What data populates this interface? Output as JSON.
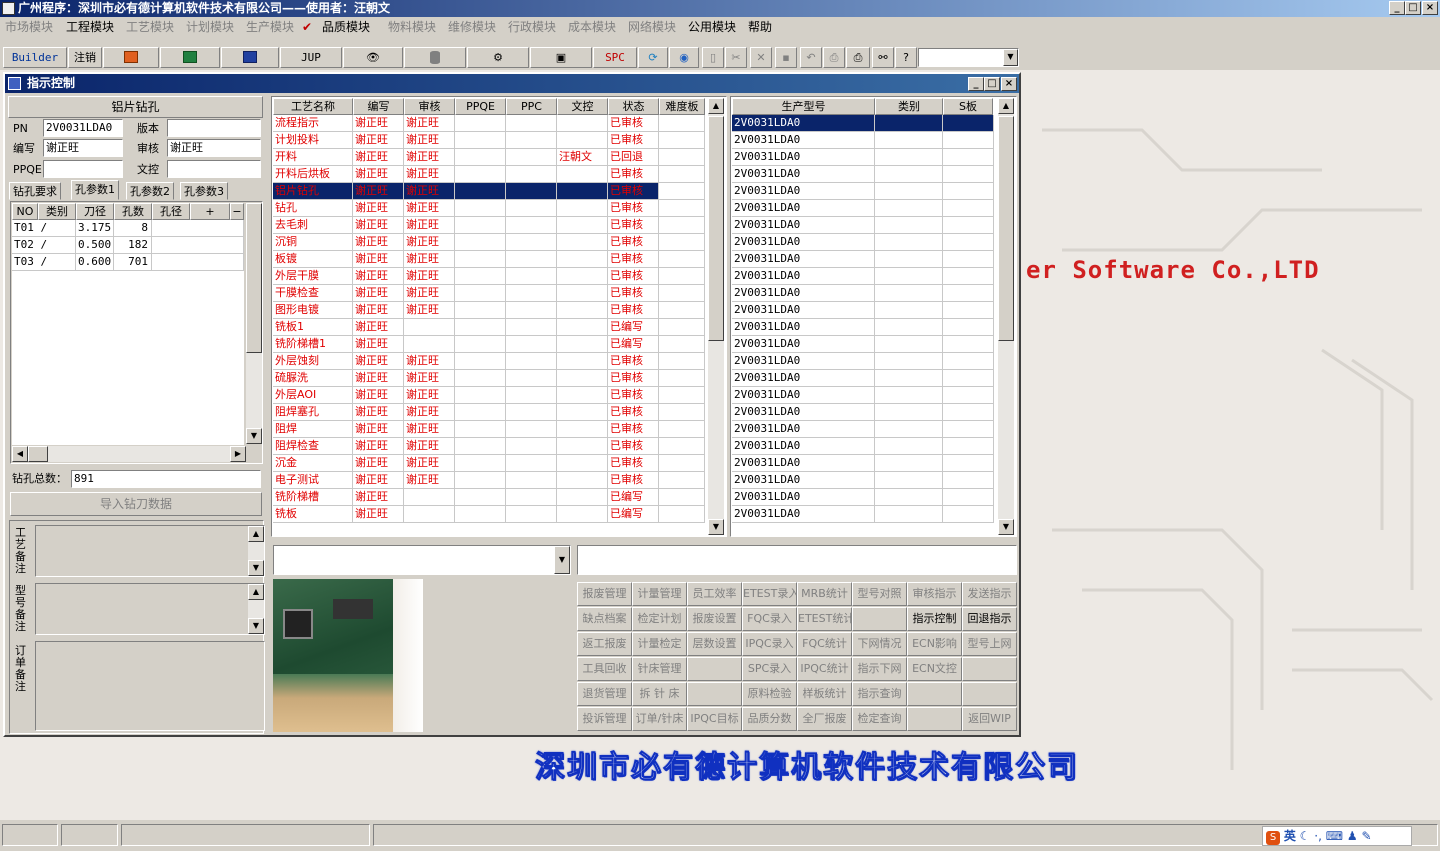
{
  "app": {
    "title": "广州程序：深圳市必有德计算机软件技术有限公司——使用者：汪朝文"
  },
  "menu": {
    "items": [
      {
        "label": "市场模块",
        "enabled": false
      },
      {
        "label": "工程模块",
        "enabled": true
      },
      {
        "label": "工艺模块",
        "enabled": false
      },
      {
        "label": "计划模块",
        "enabled": false
      },
      {
        "label": "生产模块",
        "enabled": false
      },
      {
        "label": "品质模块",
        "enabled": true
      },
      {
        "label": "物料模块",
        "enabled": false
      },
      {
        "label": "维修模块",
        "enabled": false
      },
      {
        "label": "行政模块",
        "enabled": false
      },
      {
        "label": "成本模块",
        "enabled": false
      },
      {
        "label": "网络模块",
        "enabled": false
      },
      {
        "label": "公用模块",
        "enabled": true
      },
      {
        "label": "帮助",
        "enabled": true
      }
    ]
  },
  "toolbar": {
    "builder": "Builder",
    "logout": "注销",
    "jup": "JUP",
    "spc": "SPC"
  },
  "window": {
    "title": "指示控制"
  },
  "left": {
    "section_title": "铝片钻孔",
    "pn_label": "PN",
    "pn_value": "2V0031LDA0",
    "version_label": "版本",
    "version_value": "",
    "author_label": "编写",
    "author_value": "谢正旺",
    "reviewer_label": "审核",
    "reviewer_value": "谢正旺",
    "ppqe_label": "PPQE",
    "ppqe_value": "",
    "proof_label": "文控",
    "proof_value": "",
    "tabs": [
      "钻孔要求",
      "孔参数1",
      "孔参数2",
      "孔参数3"
    ],
    "tool_headers": [
      "NO",
      "类别",
      "刀径",
      "孔数",
      "孔径",
      "+",
      "−"
    ],
    "tools": [
      {
        "no": "T01 /",
        "dia": "3.175",
        "count": "8"
      },
      {
        "no": "T02 /",
        "dia": "0.500",
        "count": "182"
      },
      {
        "no": "T03 /",
        "dia": "0.600",
        "count": "701"
      }
    ],
    "total_label": "钻孔总数：",
    "total_value": "891",
    "import_button": "导入钻刀数据",
    "note1": "工艺备注",
    "note2": "型号备注",
    "note3": "订单备注"
  },
  "process_grid": {
    "headers": [
      "工艺名称",
      "编写",
      "审核",
      "PPQE",
      "PPC",
      "文控",
      "状态",
      "难度板"
    ],
    "rows": [
      {
        "name": "流程指示",
        "author": "谢正旺",
        "reviewer": "谢正旺",
        "proof": "",
        "status": "已审核"
      },
      {
        "name": "计划投料",
        "author": "谢正旺",
        "reviewer": "谢正旺",
        "proof": "",
        "status": "已审核"
      },
      {
        "name": "开料",
        "author": "谢正旺",
        "reviewer": "谢正旺",
        "proof": "汪朝文",
        "status": "已回退"
      },
      {
        "name": "开料后烘板",
        "author": "谢正旺",
        "reviewer": "谢正旺",
        "proof": "",
        "status": "已审核"
      },
      {
        "name": "铝片钻孔",
        "author": "谢正旺",
        "reviewer": "谢正旺",
        "proof": "",
        "status": "已审核"
      },
      {
        "name": "钻孔",
        "author": "谢正旺",
        "reviewer": "谢正旺",
        "proof": "",
        "status": "已审核"
      },
      {
        "name": "去毛刺",
        "author": "谢正旺",
        "reviewer": "谢正旺",
        "proof": "",
        "status": "已审核"
      },
      {
        "name": "沉铜",
        "author": "谢正旺",
        "reviewer": "谢正旺",
        "proof": "",
        "status": "已审核"
      },
      {
        "name": "板镀",
        "author": "谢正旺",
        "reviewer": "谢正旺",
        "proof": "",
        "status": "已审核"
      },
      {
        "name": "外层干膜",
        "author": "谢正旺",
        "reviewer": "谢正旺",
        "proof": "",
        "status": "已审核"
      },
      {
        "name": "干膜检查",
        "author": "谢正旺",
        "reviewer": "谢正旺",
        "proof": "",
        "status": "已审核"
      },
      {
        "name": "图形电镀",
        "author": "谢正旺",
        "reviewer": "谢正旺",
        "proof": "",
        "status": "已审核"
      },
      {
        "name": "铣板1",
        "author": "谢正旺",
        "reviewer": "",
        "proof": "",
        "status": "已编写"
      },
      {
        "name": "铣阶梯槽1",
        "author": "谢正旺",
        "reviewer": "",
        "proof": "",
        "status": "已编写"
      },
      {
        "name": "外层蚀刻",
        "author": "谢正旺",
        "reviewer": "谢正旺",
        "proof": "",
        "status": "已审核"
      },
      {
        "name": "硫脲洗",
        "author": "谢正旺",
        "reviewer": "谢正旺",
        "proof": "",
        "status": "已审核"
      },
      {
        "name": "外层AOI",
        "author": "谢正旺",
        "reviewer": "谢正旺",
        "proof": "",
        "status": "已审核"
      },
      {
        "name": "阻焊塞孔",
        "author": "谢正旺",
        "reviewer": "谢正旺",
        "proof": "",
        "status": "已审核"
      },
      {
        "name": "阻焊",
        "author": "谢正旺",
        "reviewer": "谢正旺",
        "proof": "",
        "status": "已审核"
      },
      {
        "name": "阻焊检查",
        "author": "谢正旺",
        "reviewer": "谢正旺",
        "proof": "",
        "status": "已审核"
      },
      {
        "name": "沉金",
        "author": "谢正旺",
        "reviewer": "谢正旺",
        "proof": "",
        "status": "已审核"
      },
      {
        "name": "电子测试",
        "author": "谢正旺",
        "reviewer": "谢正旺",
        "proof": "",
        "status": "已审核"
      },
      {
        "name": "铣阶梯槽",
        "author": "谢正旺",
        "reviewer": "",
        "proof": "",
        "status": "已编写"
      },
      {
        "name": "铣板",
        "author": "谢正旺",
        "reviewer": "",
        "proof": "",
        "status": "已编写"
      }
    ],
    "selected_index": 4
  },
  "model_grid": {
    "headers": [
      "生产型号",
      "类别",
      "S板"
    ],
    "rows": [
      "2V0031LDA0",
      "2V0031LDA0",
      "2V0031LDA0",
      "2V0031LDA0",
      "2V0031LDA0",
      "2V0031LDA0",
      "2V0031LDA0",
      "2V0031LDA0",
      "2V0031LDA0",
      "2V0031LDA0",
      "2V0031LDA0",
      "2V0031LDA0",
      "2V0031LDA0",
      "2V0031LDA0",
      "2V0031LDA0",
      "2V0031LDA0",
      "2V0031LDA0",
      "2V0031LDA0",
      "2V0031LDA0",
      "2V0031LDA0",
      "2V0031LDA0",
      "2V0031LDA0",
      "2V0031LDA0",
      "2V0031LDA0"
    ],
    "selected_index": 0
  },
  "buttons": [
    [
      {
        "label": "报废管理",
        "enabled": false
      },
      {
        "label": "计量管理",
        "enabled": false
      },
      {
        "label": "员工效率",
        "enabled": false
      },
      {
        "label": "ETEST录入",
        "enabled": false
      },
      {
        "label": "MRB统计",
        "enabled": false
      },
      {
        "label": "型号对照",
        "enabled": false
      },
      {
        "label": "审核指示",
        "enabled": false
      },
      {
        "label": "发送指示",
        "enabled": false
      }
    ],
    [
      {
        "label": "缺点档案",
        "enabled": false
      },
      {
        "label": "检定计划",
        "enabled": false
      },
      {
        "label": "报废设置",
        "enabled": false
      },
      {
        "label": "FQC录入",
        "enabled": false
      },
      {
        "label": "ETEST统计",
        "enabled": false
      },
      {
        "label": "",
        "enabled": false
      },
      {
        "label": "指示控制",
        "enabled": true
      },
      {
        "label": "回退指示",
        "enabled": true
      }
    ],
    [
      {
        "label": "返工报废",
        "enabled": false
      },
      {
        "label": "计量检定",
        "enabled": false
      },
      {
        "label": "层数设置",
        "enabled": false
      },
      {
        "label": "IPQC录入",
        "enabled": false
      },
      {
        "label": "FQC统计",
        "enabled": false
      },
      {
        "label": "下网情况",
        "enabled": false
      },
      {
        "label": "ECN影响",
        "enabled": false
      },
      {
        "label": "型号上网",
        "enabled": false
      }
    ],
    [
      {
        "label": "工具回收",
        "enabled": false
      },
      {
        "label": "针床管理",
        "enabled": false
      },
      {
        "label": "",
        "enabled": false
      },
      {
        "label": "SPC录入",
        "enabled": false
      },
      {
        "label": "IPQC统计",
        "enabled": false
      },
      {
        "label": "指示下网",
        "enabled": false
      },
      {
        "label": "ECN文控",
        "enabled": false
      },
      {
        "label": "",
        "enabled": false
      }
    ],
    [
      {
        "label": "退货管理",
        "enabled": false
      },
      {
        "label": "拆 针 床",
        "enabled": false
      },
      {
        "label": "",
        "enabled": false
      },
      {
        "label": "原料检验",
        "enabled": false
      },
      {
        "label": "样板统计",
        "enabled": false
      },
      {
        "label": "指示查询",
        "enabled": false
      },
      {
        "label": "",
        "enabled": false
      },
      {
        "label": "",
        "enabled": false
      }
    ],
    [
      {
        "label": "投诉管理",
        "enabled": false
      },
      {
        "label": "订单/针床",
        "enabled": false
      },
      {
        "label": "IPQC目标",
        "enabled": false
      },
      {
        "label": "品质分数",
        "enabled": false
      },
      {
        "label": "全厂报废",
        "enabled": false
      },
      {
        "label": "检定查询",
        "enabled": false
      },
      {
        "label": "",
        "enabled": false
      },
      {
        "label": "返回WIP",
        "enabled": false
      }
    ]
  ],
  "banner": {
    "english": "er Software Co.,LTD",
    "chinese": "深圳市必有德计算机软件技术有限公司"
  },
  "tray": {
    "ime": "英"
  },
  "colors": {
    "title_blue": "#0a246a",
    "selected": "#0a246a",
    "status_red": "#e00000",
    "banner_red": "#d02020",
    "banner_blue": "#1030c0"
  }
}
